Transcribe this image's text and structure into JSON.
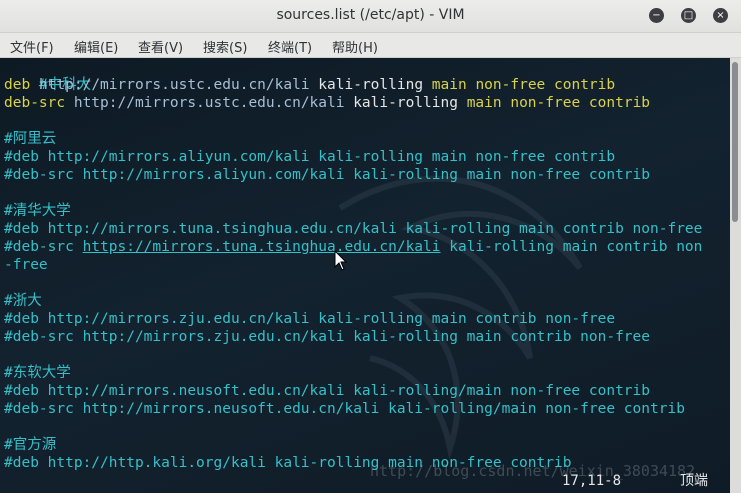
{
  "window": {
    "title": "sources.list (/etc/apt) - VIM",
    "buttons": {
      "minimize": "minimize-icon",
      "maximize": "maximize-icon",
      "close": "close-icon"
    }
  },
  "menu": {
    "file": "文件(F)",
    "edit": "编辑(E)",
    "view": "查看(V)",
    "search": "搜索(S)",
    "terminal": "终端(T)",
    "help": "帮助(H)"
  },
  "lines": {
    "l1": {
      "a": "#中科大"
    },
    "l2": {
      "a": "deb",
      "b": "http://mirrors.ustc.edu.cn/kali",
      "c": "kali-rolling",
      "d": "main non-free contrib"
    },
    "l3": {
      "a": "deb-src",
      "b": "http://mirrors.ustc.edu.cn/kali",
      "c": "kali-rolling",
      "d": "main non-free contrib"
    },
    "l5": {
      "a": "#阿里云"
    },
    "l6": {
      "a": "#deb http://mirrors.aliyun.com/kali kali-rolling main non-free contrib"
    },
    "l7": {
      "a": "#deb-src http://mirrors.aliyun.com/kali kali-rolling main non-free contrib"
    },
    "l9": {
      "a": "#清华大学"
    },
    "l10": {
      "a": "#deb http://mirrors.tuna.tsinghua.edu.cn/kali kali-rolling main contrib non-free"
    },
    "l11": {
      "a": "#deb-src ",
      "b": "https://mirrors.tuna.tsinghua.edu.cn/kali",
      "c": " kali-rolling main contrib non"
    },
    "l12": {
      "a": "-free"
    },
    "l14": {
      "a": "#浙大"
    },
    "l15": {
      "a": "#deb http://mirrors.zju.edu.cn/kali kali-rolling main contrib non-free"
    },
    "l16": {
      "a": "#deb-src http://mirrors.zju.edu.cn/kali kali-rolling main contrib non-free"
    },
    "l18": {
      "a": "#东软大学"
    },
    "l19": {
      "a": "#deb http://mirrors.neusoft.edu.cn/kali kali-rolling/main non-free contrib"
    },
    "l20": {
      "a": "#deb-src http://mirrors.neusoft.edu.cn/kali kali-rolling/main non-free contrib"
    },
    "l22": {
      "a": "#官方源"
    },
    "l23": {
      "a": "#deb http://http.kali.org/kali kali-rolling main non-free contrib"
    }
  },
  "status": {
    "position": "17,11-8",
    "scroll": "顶端"
  },
  "watermark": "http://blog.csdn.net/weixin_38034182"
}
